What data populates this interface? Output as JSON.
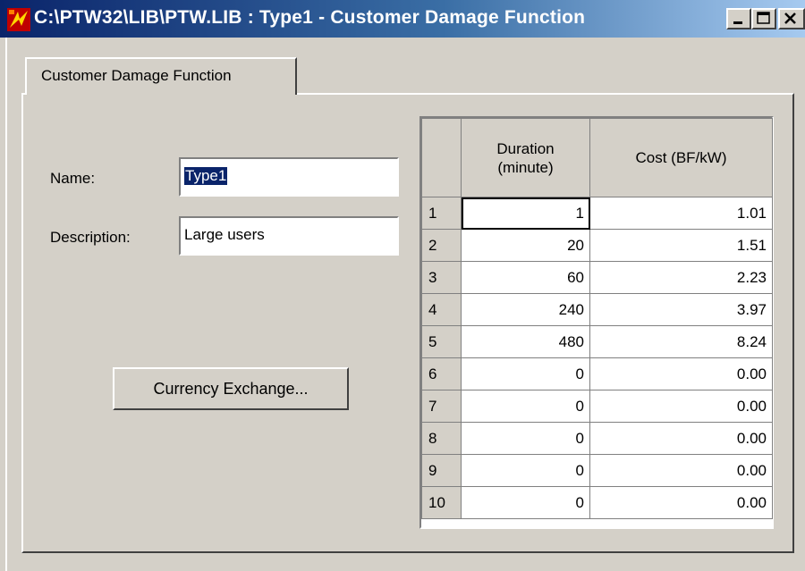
{
  "window": {
    "title": "C:\\PTW32\\LIB\\PTW.LIB : Type1 - Customer Damage Function",
    "icon": "ptw-app-icon",
    "controls": [
      "minimize-icon",
      "maximize-icon",
      "close-icon"
    ]
  },
  "tabs": [
    {
      "label": "Customer Damage Function",
      "active": true
    }
  ],
  "form": {
    "name_label": "Name:",
    "name_value": "Type1",
    "description_label": "Description:",
    "description_value": "Large users",
    "currency_button": "Currency Exchange..."
  },
  "grid": {
    "columns": [
      "Duration\n(minute)",
      "Cost (BF/kW)"
    ],
    "rows": [
      {
        "row": "1",
        "duration": "1",
        "cost": "1.01"
      },
      {
        "row": "2",
        "duration": "20",
        "cost": "1.51"
      },
      {
        "row": "3",
        "duration": "60",
        "cost": "2.23"
      },
      {
        "row": "4",
        "duration": "240",
        "cost": "3.97"
      },
      {
        "row": "5",
        "duration": "480",
        "cost": "8.24"
      },
      {
        "row": "6",
        "duration": "0",
        "cost": "0.00"
      },
      {
        "row": "7",
        "duration": "0",
        "cost": "0.00"
      },
      {
        "row": "8",
        "duration": "0",
        "cost": "0.00"
      },
      {
        "row": "9",
        "duration": "0",
        "cost": "0.00"
      },
      {
        "row": "10",
        "duration": "0",
        "cost": "0.00"
      }
    ]
  },
  "colors": {
    "titlebar_start": "#0a246a",
    "titlebar_end": "#a6caf0",
    "face": "#d4d0c8",
    "selection": "#0a246a"
  }
}
